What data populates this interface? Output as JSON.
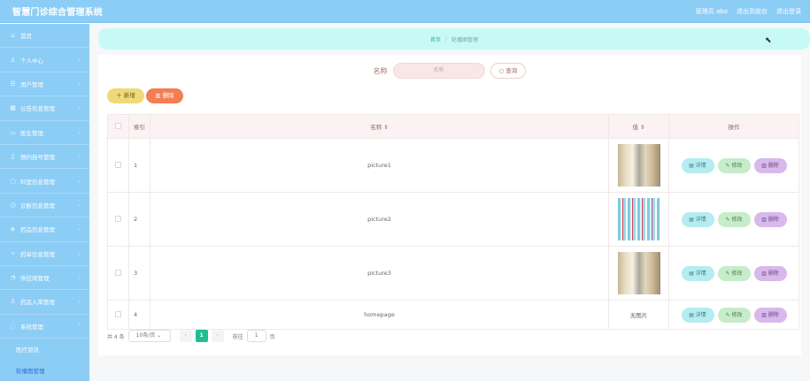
{
  "app": {
    "title": "智慧门诊综合管理系统",
    "user_label": "管理员 abo",
    "to_dashboard": "退出到前台",
    "logout": "退出登录"
  },
  "sidebar": {
    "items": [
      {
        "label": "首页",
        "icon": "home-icon",
        "glyph": "⌂",
        "arrow": ""
      },
      {
        "label": "个人中心",
        "icon": "user-icon",
        "glyph": "♙",
        "arrow": "⌄"
      },
      {
        "label": "用户管理",
        "icon": "users-icon",
        "glyph": "☰",
        "arrow": "⌄"
      },
      {
        "label": "公告信息管理",
        "icon": "notice-icon",
        "glyph": "▦",
        "arrow": "⌄"
      },
      {
        "label": "医生管理",
        "icon": "doctor-icon",
        "glyph": "▭",
        "arrow": "⌄"
      },
      {
        "label": "预约挂号管理",
        "icon": "calendar-icon",
        "glyph": "▯",
        "arrow": "⌄"
      },
      {
        "label": "科室信息管理",
        "icon": "department-icon",
        "glyph": "▢",
        "arrow": "⌄"
      },
      {
        "label": "诊断信息管理",
        "icon": "diagnosis-icon",
        "glyph": "◷",
        "arrow": "⌄"
      },
      {
        "label": "药品信息管理",
        "icon": "medicine-icon",
        "glyph": "◈",
        "arrow": "⌄"
      },
      {
        "label": "药单信息管理",
        "icon": "prescription-icon",
        "glyph": "✧",
        "arrow": "⌄"
      },
      {
        "label": "供应商管理",
        "icon": "supplier-icon",
        "glyph": "◔",
        "arrow": "⌄"
      },
      {
        "label": "药品入库管理",
        "icon": "inventory-icon",
        "glyph": "♙",
        "arrow": "⌄"
      },
      {
        "label": "系统管理",
        "icon": "system-icon",
        "glyph": "◌",
        "arrow": "⌃"
      }
    ],
    "sub_items": [
      {
        "label": "医疗资讯",
        "active": false
      },
      {
        "label": "轮播图管理",
        "active": true
      }
    ]
  },
  "breadcrumb": {
    "home": "首页",
    "separator": "/",
    "current": "轮播图管理"
  },
  "search": {
    "label": "名称",
    "placeholder": "名称",
    "button": "查询"
  },
  "actions": {
    "add": "新增",
    "delete": "删除"
  },
  "table": {
    "headers": {
      "index": "索引",
      "name": "名称",
      "value": "值",
      "ops": "操作"
    },
    "rows": [
      {
        "index": "1",
        "name": "picture1",
        "image": "corridor",
        "image_text": ""
      },
      {
        "index": "2",
        "name": "picture2",
        "image": "wave",
        "image_text": ""
      },
      {
        "index": "3",
        "name": "picture3",
        "image": "corridor",
        "image_text": ""
      },
      {
        "index": "4",
        "name": "homepage",
        "image": "none",
        "image_text": "无图片"
      }
    ],
    "op_labels": {
      "detail": "详情",
      "edit": "修改",
      "remove": "删除"
    }
  },
  "pagination": {
    "total": "共 4 条",
    "page_size": "10条/页",
    "current_page": "1",
    "goto_label": "前往",
    "goto_value": "1",
    "page_suffix": "页"
  },
  "colors": {
    "sidebar": "#8ccdf6",
    "breadcrumb_bg": "#c7faf6",
    "add_button": "#efd978",
    "delete_button": "#f37e53",
    "detail_button": "#b4ecf0",
    "edit_button": "#c6ecc9",
    "remove_button": "#d7b9ec",
    "pager_active": "#1fbe8f"
  }
}
